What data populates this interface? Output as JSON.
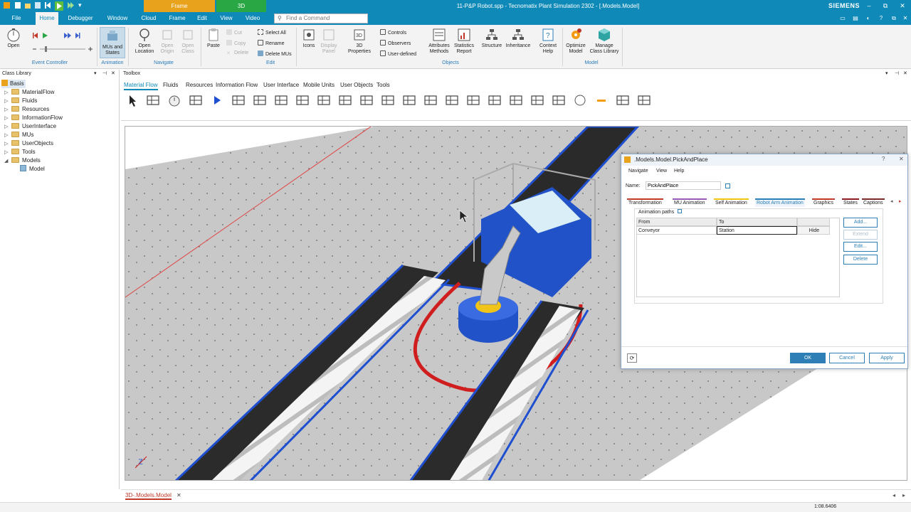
{
  "titlebar": {
    "title": "11-P&P Robot.spp - Tecnomatix Plant Simulation 2302 - [.Models.Model]",
    "context_tabs": [
      "Frame",
      "3D"
    ],
    "brand": "SIEMENS",
    "window_buttons": [
      "–",
      "⧉",
      "✕"
    ]
  },
  "menubar": {
    "tabs": [
      "File",
      "Home",
      "Debugger",
      "Window",
      "Cloud",
      "Frame",
      "Edit",
      "View",
      "Video"
    ],
    "active": "Home",
    "search_placeholder": "Find a Command"
  },
  "ribbon": {
    "event_controller": {
      "open": "Open",
      "group": "Event Controller"
    },
    "animation": {
      "mus_states": "MUs and States",
      "group": "Animation"
    },
    "navigate": {
      "open_location": "Open Location",
      "open_origin": "Open Origin",
      "open_class": "Open Class",
      "group": "Navigate"
    },
    "edit": {
      "paste": "Paste",
      "cut": "Cut",
      "copy": "Copy",
      "delete": "Delete",
      "select_all": "Select All",
      "rename": "Rename",
      "delete_mus": "Delete MUs",
      "group": "Edit"
    },
    "objects": {
      "icons": "Icons",
      "display_panel": "Display Panel",
      "properties_3d": "3D Properties",
      "controls": "Controls",
      "observers": "Observers",
      "user_defined": "User-defined",
      "attributes_methods": "Attributes Methods",
      "statistics_report": "Statistics Report",
      "structure": "Structure",
      "inheritance": "Inheritance",
      "context_help": "Context Help",
      "group": "Objects"
    },
    "model": {
      "optimize_model": "Optimize Model",
      "manage_class_library": "Manage Class Library",
      "group": "Model"
    }
  },
  "class_library": {
    "header": "Class Library",
    "root": "Basis",
    "items": [
      "MaterialFlow",
      "Fluids",
      "Resources",
      "InformationFlow",
      "UserInterface",
      "MUs",
      "UserObjects",
      "Tools",
      "Models"
    ],
    "model_child": "Model"
  },
  "toolbox": {
    "header": "Toolbox",
    "tabs": [
      "Material Flow",
      "Fluids",
      "Resources",
      "Information Flow",
      "User Interface",
      "Mobile Units",
      "User Objects",
      "Tools"
    ],
    "active": "Material Flow"
  },
  "dialog": {
    "title": ".Models.Model.PickAndPlace",
    "menu": [
      "Navigate",
      "View",
      "Help"
    ],
    "name_label": "Name:",
    "name_value": "PickAndPlace",
    "tabs": [
      "Transformation",
      "MU Animation",
      "Self Animation",
      "Robot Arm Animation",
      "Graphics",
      "States",
      "Captions"
    ],
    "active_tab": "Robot Arm Animation",
    "tab_colors": [
      "#c0392b",
      "#9b59b6",
      "#f1c40f",
      "#2980b9",
      "#c0392b",
      "#8e1c1c",
      "#7f2a2a"
    ],
    "group_label": "Animation paths",
    "table_headers": [
      "From",
      "To",
      ""
    ],
    "rows": [
      {
        "from": "Conveyor",
        "to": "Station",
        "action": "Hide"
      }
    ],
    "side_buttons": [
      "Add...",
      "Extend",
      "Edit...",
      "Delete"
    ],
    "footer_buttons": [
      "OK",
      "Cancel",
      "Apply"
    ]
  },
  "document_tab": "3D-.Models.Model",
  "status": {
    "zoom": "1:08.6406"
  }
}
